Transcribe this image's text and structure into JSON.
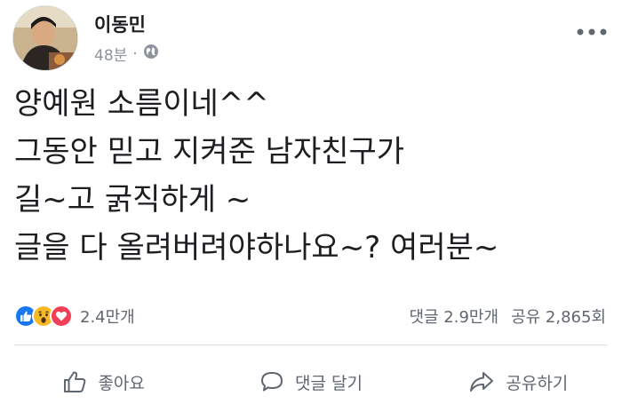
{
  "post": {
    "author": "이동민",
    "time": "48분",
    "separator": "·",
    "privacy_icon": "globe-icon",
    "more_icon": "ellipsis-icon",
    "content_lines": [
      "양예원 소름이네^^",
      "그동안 믿고 지켜준 남자친구가",
      "길~고 굵직하게 ~",
      "글을 다 올려버려야하나요~? 여러분~"
    ]
  },
  "stats": {
    "reaction_icons": [
      "like-icon",
      "wow-icon",
      "love-icon"
    ],
    "reaction_count": "2.4만개",
    "comments": "댓글 2.9만개",
    "shares": "공유 2,865회"
  },
  "actions": {
    "like": "좋아요",
    "comment": "댓글 달기",
    "share": "공유하기"
  },
  "colors": {
    "like_blue": "#1877f2",
    "wow_yellow": "#f7b928",
    "love_red": "#f33e58",
    "muted": "#606770"
  }
}
